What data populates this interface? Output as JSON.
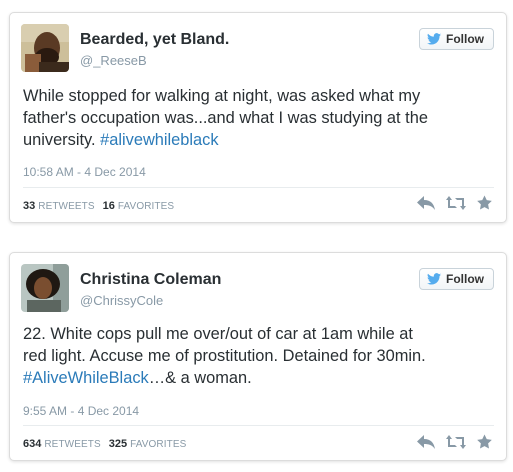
{
  "tweets": [
    {
      "display_name": "Bearded, yet Bland.",
      "handle": "@_ReeseB",
      "follow_label": "Follow",
      "text_lines": [
        {
          "plain": "While stopped for walking at night, was asked what my",
          "tag": ""
        },
        {
          "plain": "father's occupation was...and what I was studying at the",
          "tag": ""
        },
        {
          "plain": "university. ",
          "tag": "#alivewhileblack"
        }
      ],
      "timestamp": "10:58 AM - 4 Dec 2014",
      "retweets": "33",
      "retweets_label": "RETWEETS",
      "favorites": "16",
      "favorites_label": "FAVORITES"
    },
    {
      "display_name": "Christina Coleman",
      "handle": "@ChrissyCole",
      "follow_label": "Follow",
      "text_lines": [
        {
          "plain": "22. White cops pull me over/out of car at 1am while at",
          "tag": "",
          "after": ""
        },
        {
          "plain": "red light. Accuse me of prostitution. Detained for 30min.",
          "tag": "",
          "after": ""
        },
        {
          "plain": " ",
          "tag": "#AliveWhileBlack",
          "after": "…& a woman."
        }
      ],
      "timestamp": "9:55 AM - 4 Dec 2014",
      "retweets": "634",
      "retweets_label": "RETWEETS",
      "favorites": "325",
      "favorites_label": "FAVORITES"
    }
  ],
  "colors": {
    "link": "#2b7bb9",
    "twitter_blue": "#55acee",
    "muted": "#8899a6",
    "text": "#292f33"
  },
  "icons": [
    "twitter-bird-icon",
    "reply-icon",
    "retweet-icon",
    "favorite-star-icon"
  ]
}
